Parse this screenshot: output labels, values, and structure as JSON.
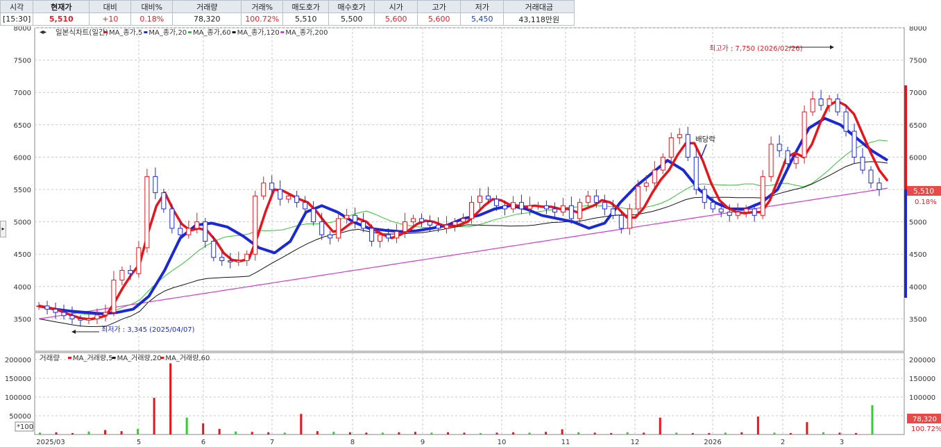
{
  "quote_bar": {
    "headers": [
      "시각",
      "현재가",
      "대비",
      "대비%",
      "거래량",
      "거래%",
      "매도호가",
      "매수호가",
      "시가",
      "고가",
      "저가",
      "거래대금"
    ],
    "values": [
      "[15:30]",
      "5,510",
      "+10",
      "0.18%",
      "78,320",
      "100.72%",
      "5,510",
      "5,500",
      "5,600",
      "5,600",
      "5,450",
      "43,118만원"
    ],
    "value_colors": [
      "#222222",
      "#e0202a",
      "#e0202a",
      "#e0202a",
      "#222222",
      "#e0202a",
      "#222222",
      "#222222",
      "#e0202a",
      "#e0202a",
      "#1a3fc8",
      "#222222"
    ]
  },
  "price_panel": {
    "title": "일본식차트(일간)",
    "legend": [
      {
        "label": "MA_종가,5",
        "color": "#e8141c"
      },
      {
        "label": "MA_종가,20",
        "color": "#1a28d6"
      },
      {
        "label": "MA_종가,60",
        "color": "#33c233"
      },
      {
        "label": "MA_종가,120",
        "color": "#111111"
      },
      {
        "label": "MA_종가,200",
        "color": "#d23ad2"
      }
    ],
    "y_ticks": [
      "8000",
      "7500",
      "7000",
      "6500",
      "6000",
      "5500",
      "5000",
      "4500",
      "4000",
      "3500"
    ],
    "high_label": "최고가 : 7,750 (2026/02/26)",
    "low_label": "최저가 : 3,345 (2025/04/07)",
    "event_label": "배당락",
    "price_tag": "5,510",
    "change_tag": "0.18%"
  },
  "volume_panel": {
    "title": "거래량",
    "legend": [
      {
        "label": "MA_거래량,5",
        "color": "#e8141c"
      },
      {
        "label": "MA_거래량,20",
        "color": "#111111"
      },
      {
        "label": "MA_거래량,60",
        "color": "#e8141c"
      }
    ],
    "y_ticks": [
      "200000",
      "150000",
      "100000",
      "50000"
    ],
    "scale_note": "*100",
    "volume_tag": "78,320",
    "volume_pct_tag": "100.72%"
  },
  "x_labels": [
    "2025/03",
    "4",
    "5",
    "6",
    "7",
    "8",
    "9",
    "10",
    "11",
    "12",
    "2026",
    "2",
    "3"
  ],
  "chart_data": {
    "type": "candlestick",
    "title": "일본식차트(일간)",
    "x": [
      "2025/03",
      "4",
      "5",
      "6",
      "7",
      "8",
      "9",
      "10",
      "11",
      "12",
      "2026",
      "2",
      "3"
    ],
    "ylim": [
      3000,
      8000
    ],
    "volume_ylim": [
      0,
      200000
    ],
    "colors": {
      "up": "#e8141c",
      "down": "#1a28d6",
      "ma5": "#e8141c",
      "ma20": "#1a28d6",
      "ma60": "#33c233",
      "ma120": "#111111",
      "ma200": "#d23ad2",
      "vol_up": "#e8141c",
      "vol_down": "#33cc33"
    },
    "last": {
      "close": 5510,
      "open": 5600,
      "high": 5600,
      "low": 5450,
      "volume": 78320
    },
    "high": {
      "value": 7750,
      "date": "2026/02/26"
    },
    "low": {
      "value": 3345,
      "date": "2025/04/07"
    },
    "close_series": [
      3700,
      3650,
      3600,
      3550,
      3500,
      3480,
      3500,
      3560,
      3600,
      4100,
      4250,
      4200,
      4600,
      5700,
      5450,
      5200,
      4900,
      4800,
      4900,
      5000,
      4700,
      4450,
      4400,
      4380,
      4400,
      4500,
      5400,
      5600,
      5500,
      5350,
      5400,
      5300,
      5200,
      5000,
      4800,
      4750,
      5050,
      5100,
      5000,
      4900,
      4700,
      4800,
      4750,
      4850,
      5000,
      5050,
      5000,
      4950,
      4900,
      4950,
      5000,
      5050,
      5300,
      5400,
      5350,
      5250,
      5200,
      5300,
      5200,
      5250,
      5250,
      5200,
      5150,
      5250,
      5050,
      5300,
      5400,
      5300,
      5200,
      5100,
      4900,
      5200,
      5550,
      5600,
      5800,
      6000,
      6300,
      6350,
      6000,
      5500,
      5300,
      5200,
      5150,
      5100,
      5150,
      5200,
      5100,
      5700,
      6200,
      6100,
      5900,
      6000,
      6700,
      6900,
      6800,
      6900,
      6700,
      6400,
      6000,
      5800,
      5600,
      5500
    ],
    "ma20_series": [
      3700,
      3650,
      3620,
      3600,
      3580,
      3600,
      3650,
      3850,
      4250,
      4750,
      4950,
      4980,
      4920,
      4780,
      4600,
      4520,
      4700,
      5150,
      5250,
      5150,
      5000,
      4900,
      4870,
      4850,
      4860,
      4900,
      4950,
      5050,
      5100,
      5200,
      5250,
      5200,
      5100,
      5050,
      5000,
      4900,
      4980,
      5300,
      5550,
      5750,
      5950,
      5800,
      5500,
      5300,
      5200,
      5200,
      5300,
      5500,
      6000,
      6450,
      6600,
      6500,
      6300,
      6100,
      5950
    ],
    "volume_series": [
      5000,
      6000,
      4000,
      8000,
      12000,
      9000,
      15000,
      98000,
      190000,
      45000,
      30000,
      15000,
      8000,
      7000,
      6000,
      5000,
      55000,
      9000,
      7000,
      6000,
      5000,
      5000,
      6000,
      7000,
      5000,
      6000,
      5000,
      4000,
      5000,
      6000,
      5000,
      7000,
      14000,
      6000,
      5000,
      4000,
      6000,
      5000,
      45000,
      5000,
      4000,
      4000,
      5000,
      6000,
      48000,
      5000,
      4000,
      33000,
      6000,
      5000,
      4000,
      78320
    ],
    "volume_last": 78320
  }
}
